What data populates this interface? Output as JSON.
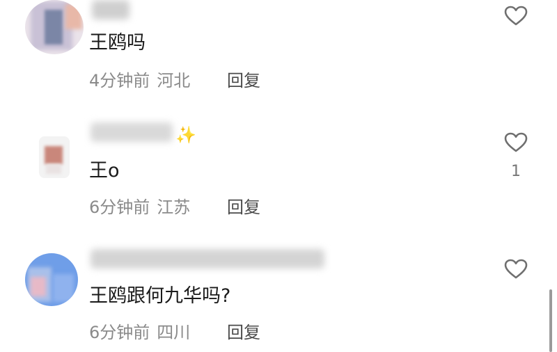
{
  "comments": [
    {
      "text": "王鸥吗",
      "time": "4分钟前",
      "location": "河北",
      "reply_label": "回复",
      "like_count": ""
    },
    {
      "text": "王o",
      "time": "6分钟前",
      "location": "江苏",
      "reply_label": "回复",
      "like_count": "1",
      "username_emoji": "✨"
    },
    {
      "text": "王鸥跟何九华吗?",
      "time": "6分钟前",
      "location": "四川",
      "reply_label": "回复",
      "like_count": ""
    }
  ],
  "icons": {
    "like": "heart-outline-icon"
  },
  "colors": {
    "text": "#1a1a1a",
    "meta": "#8a8a8a",
    "icon": "#6f6f6f"
  }
}
